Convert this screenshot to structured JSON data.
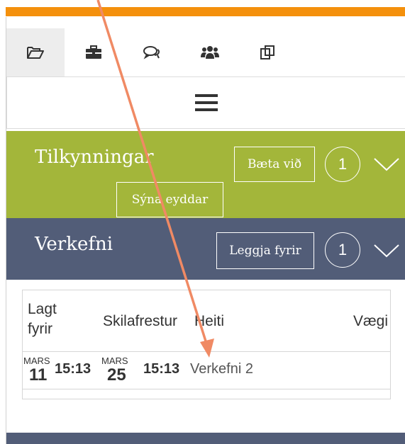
{
  "tabs": [
    {
      "icon": "folder-open-icon"
    },
    {
      "icon": "briefcase-icon"
    },
    {
      "icon": "comments-icon"
    },
    {
      "icon": "users-icon"
    },
    {
      "icon": "clone-icon"
    }
  ],
  "menu": {
    "icon": "hamburger-menu-icon"
  },
  "notifications": {
    "title": "Tilkynningar",
    "add_button": "Bæta við",
    "count": "1",
    "show_deleted_button": "Sýna eyddar"
  },
  "assignments": {
    "title": "Verkefni",
    "submit_button": "Leggja fyrir",
    "count": "1"
  },
  "table": {
    "headers": {
      "posted_line1": "Lagt",
      "posted_line2": "fyrir",
      "deadline": "Skilafrestur",
      "name": "Heiti",
      "weight": "Vægi"
    },
    "rows": [
      {
        "posted_month": "MARS",
        "posted_day": "11",
        "posted_time": "15:13",
        "due_month": "MARS",
        "due_day": "25",
        "due_time": "15:13",
        "name": "Verkefni 2",
        "weight": ""
      }
    ]
  },
  "colors": {
    "accent_orange": "#f4900c",
    "notifications_bg": "#a3b63a",
    "assignments_bg": "#525d78",
    "annotation_arrow": "#f08a64"
  }
}
